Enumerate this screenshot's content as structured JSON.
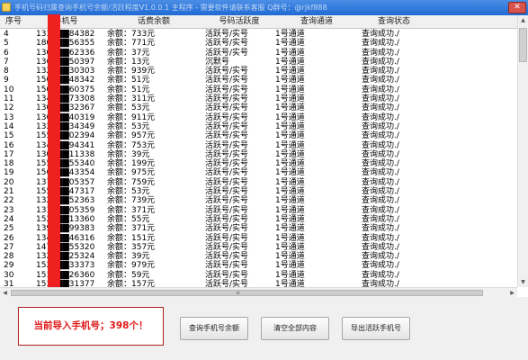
{
  "window": {
    "title": "手机号码归属查询手机号余额/活跃程度V1.0.0.1 主程序 - 需要软件请联系客服 Q群号：@rjkf888",
    "close_glyph": "✕"
  },
  "table": {
    "columns": [
      "序号",
      "手机号",
      "话费余额",
      "号码活跃度",
      "查询通道",
      "查询状态"
    ],
    "rows": [
      {
        "no": "4",
        "phone": "1331▇▇84382",
        "balance": "余额：733元",
        "activity": "活跃号/实号",
        "channel": "1号通道",
        "status": "查询成功./"
      },
      {
        "no": "5",
        "phone": "1807▇▇56355",
        "balance": "余额：771元",
        "activity": "活跃号/实号",
        "channel": "1号通道",
        "status": "查询成功./"
      },
      {
        "no": "6",
        "phone": "1303▇▇62336",
        "balance": "余额：37元",
        "activity": "活跃号/实号",
        "channel": "1号通道",
        "status": "查询成功./"
      },
      {
        "no": "7",
        "phone": "1364▇▇50397",
        "balance": "余额：13元",
        "activity": "沉默号",
        "channel": "1号通道",
        "status": "查询成功./"
      },
      {
        "no": "8",
        "phone": "1324▇▇30303",
        "balance": "余额：939元",
        "activity": "活跃号/实号",
        "channel": "1号通道",
        "status": "查询成功./"
      },
      {
        "no": "9",
        "phone": "1507▇▇48342",
        "balance": "余额：51元",
        "activity": "活跃号/实号",
        "channel": "1号通道",
        "status": "查询成功./"
      },
      {
        "no": "10",
        "phone": "1504▇▇60375",
        "balance": "余额：51元",
        "activity": "活跃号/实号",
        "channel": "1号通道",
        "status": "查询成功./"
      },
      {
        "no": "11",
        "phone": "1341▇▇73308",
        "balance": "余额：311元",
        "activity": "活跃号/实号",
        "channel": "1号通道",
        "status": "查询成功./"
      },
      {
        "no": "12",
        "phone": "1309▇▇32367",
        "balance": "余额：53元",
        "activity": "活跃号/实号",
        "channel": "1号通道",
        "status": "查询成功./"
      },
      {
        "no": "13",
        "phone": "1361▇▇40319",
        "balance": "余额：911元",
        "activity": "活跃号/实号",
        "channel": "1号通道",
        "status": "查询成功./"
      },
      {
        "no": "14",
        "phone": "1324▇▇34349",
        "balance": "余额：53元",
        "activity": "活跃号/实号",
        "channel": "1号通道",
        "status": "查询成功./"
      },
      {
        "no": "15",
        "phone": "1551▇▇02394",
        "balance": "余额：957元",
        "activity": "活跃号/实号",
        "channel": "1号通道",
        "status": "查询成功./"
      },
      {
        "no": "16",
        "phone": "1342▇▇94341",
        "balance": "余额：753元",
        "activity": "活跃号/实号",
        "channel": "1号通道",
        "status": "查询成功./"
      },
      {
        "no": "17",
        "phone": "1309▇▇11338",
        "balance": "余额：39元",
        "activity": "活跃号/实号",
        "channel": "1号通道",
        "status": "查询成功./"
      },
      {
        "no": "18",
        "phone": "1557▇▇55340",
        "balance": "余额：199元",
        "activity": "活跃号/实号",
        "channel": "1号通道",
        "status": "查询成功./"
      },
      {
        "no": "19",
        "phone": "1564▇▇43354",
        "balance": "余额：975元",
        "activity": "活跃号/实号",
        "channel": "1号通道",
        "status": "查询成功./"
      },
      {
        "no": "20",
        "phone": "1379▇▇05357",
        "balance": "余额：759元",
        "activity": "活跃号/实号",
        "channel": "1号通道",
        "status": "查询成功./"
      },
      {
        "no": "21",
        "phone": "1550▇▇47317",
        "balance": "余额：53元",
        "activity": "活跃号/实号",
        "channel": "1号通道",
        "status": "查询成功./"
      },
      {
        "no": "22",
        "phone": "1328▇▇52363",
        "balance": "余额：739元",
        "activity": "活跃号/实号",
        "channel": "1号通道",
        "status": "查询成功./"
      },
      {
        "no": "23",
        "phone": "1319▇▇05359",
        "balance": "余额：371元",
        "activity": "活跃号/实号",
        "channel": "1号通道",
        "status": "查询成功./"
      },
      {
        "no": "24",
        "phone": "1520▇▇13360",
        "balance": "余额：55元",
        "activity": "活跃号/实号",
        "channel": "1号通道",
        "status": "查询成功./"
      },
      {
        "no": "25",
        "phone": "1398▇▇99383",
        "balance": "余额：371元",
        "activity": "活跃号/实号",
        "channel": "1号通道",
        "status": "查询成功./"
      },
      {
        "no": "26",
        "phone": "1341▇▇46316",
        "balance": "余额：151元",
        "activity": "活跃号/实号",
        "channel": "1号通道",
        "status": "查询成功./"
      },
      {
        "no": "27",
        "phone": "1471▇▇55320",
        "balance": "余额：357元",
        "activity": "活跃号/实号",
        "channel": "1号通道",
        "status": "查询成功./"
      },
      {
        "no": "28",
        "phone": "1329▇▇25324",
        "balance": "余额：39元",
        "activity": "活跃号/实号",
        "channel": "1号通道",
        "status": "查询成功./"
      },
      {
        "no": "29",
        "phone": "1520▇▇33373",
        "balance": "余额：979元",
        "activity": "活跃号/实号",
        "channel": "1号通道",
        "status": "查询成功./"
      },
      {
        "no": "30",
        "phone": "1517▇▇26360",
        "balance": "余额：59元",
        "activity": "活跃号/实号",
        "channel": "1号通道",
        "status": "查询成功./"
      },
      {
        "no": "31",
        "phone": "1537▇▇31377",
        "balance": "余额：157元",
        "activity": "活跃号/实号",
        "channel": "1号通道",
        "status": "查询成功./"
      }
    ]
  },
  "scroll": {
    "up": "▲",
    "down": "▼",
    "left": "◀",
    "right": "▶",
    "grip": "≡"
  },
  "footer": {
    "imported_count_text": "当前导入手机号；398个！",
    "buttons": {
      "query_balance": "查询手机号余额",
      "clear_all": "清空全部内容",
      "export_active": "导出活跃手机号"
    }
  }
}
